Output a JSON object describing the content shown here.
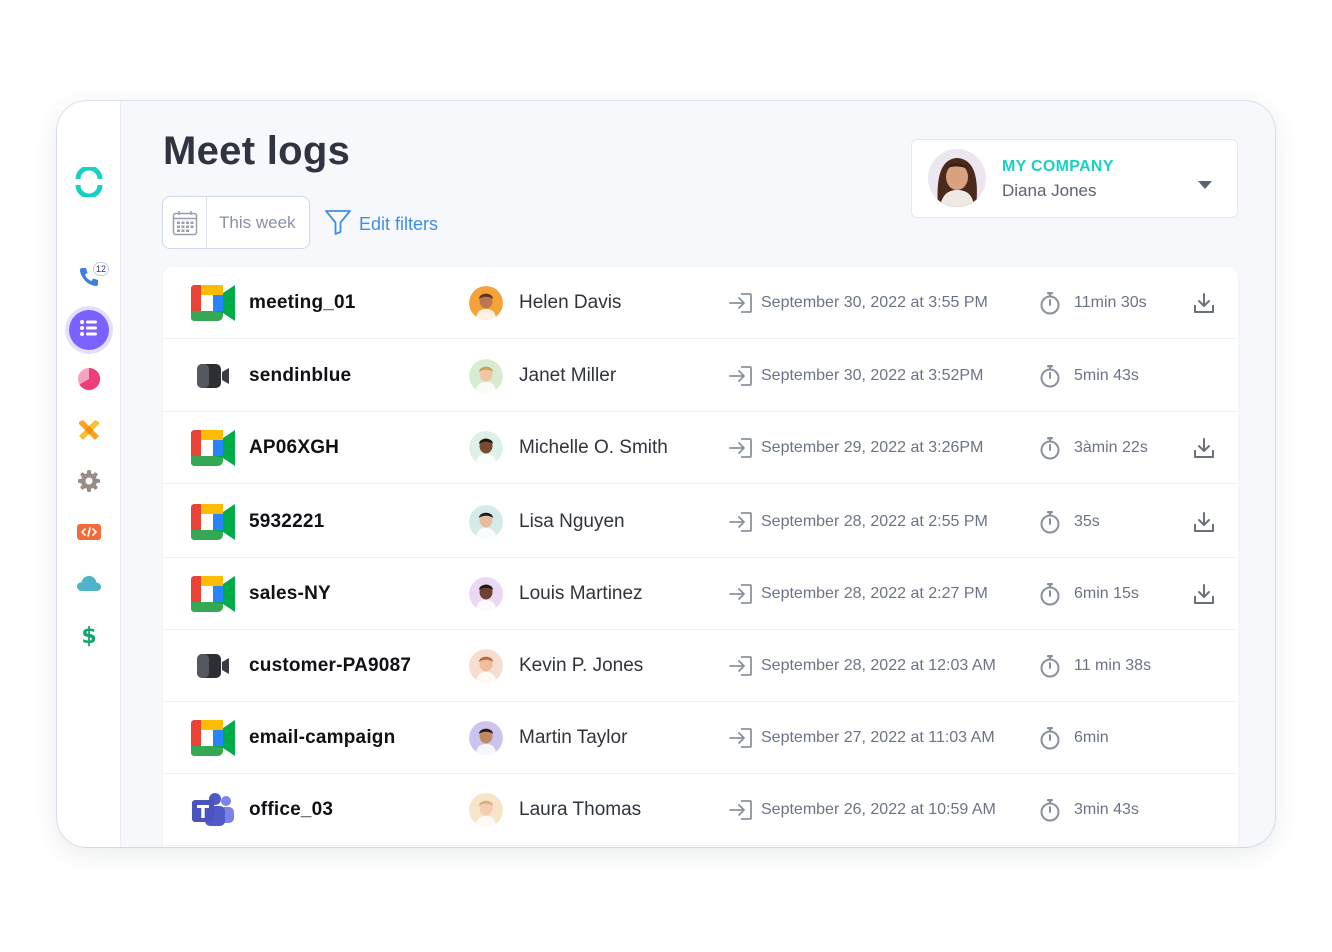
{
  "header": {
    "title": "Meet logs"
  },
  "filters": {
    "date_range": "This week",
    "edit_label": "Edit filters"
  },
  "company": {
    "name": "MY COMPANY",
    "user": "Diana Jones"
  },
  "sidebar": {
    "items": [
      {
        "id": "calls",
        "icon": "phone-icon",
        "badge": "12"
      },
      {
        "id": "logs",
        "icon": "list-icon",
        "active": true
      },
      {
        "id": "reports",
        "icon": "pie-chart-icon"
      },
      {
        "id": "tools",
        "icon": "tools-icon"
      },
      {
        "id": "settings",
        "icon": "gear-icon"
      },
      {
        "id": "developer",
        "icon": "code-icon"
      },
      {
        "id": "cloud",
        "icon": "cloud-icon"
      },
      {
        "id": "billing",
        "icon": "dollar-icon",
        "symbol": "$"
      }
    ]
  },
  "colors": {
    "accent": "#7b61ff",
    "brand": "#19d0c4",
    "link": "#3f90e4",
    "muted_text": "#6b7486"
  },
  "logs": [
    {
      "platform": "google-meet",
      "name": "meeting_01",
      "person": "Helen Davis",
      "date": "September 30, 2022 at 3:55 PM",
      "duration": "11min 30s",
      "download": true
    },
    {
      "platform": "zoom",
      "name": "sendinblue",
      "person": "Janet Miller",
      "date": "September 30, 2022 at 3:52PM",
      "duration": "5min 43s",
      "download": false
    },
    {
      "platform": "google-meet",
      "name": "AP06XGH",
      "person": "Michelle O. Smith",
      "date": "September 29, 2022 at 3:26PM",
      "duration": "3àmin 22s",
      "download": true
    },
    {
      "platform": "google-meet",
      "name": "5932221",
      "person": "Lisa Nguyen",
      "date": "September 28, 2022 at 2:55 PM",
      "duration": "35s",
      "download": true
    },
    {
      "platform": "google-meet",
      "name": "sales-NY",
      "person": "Louis  Martinez",
      "date": "September 28, 2022 at 2:27 PM",
      "duration": "6min 15s",
      "download": true
    },
    {
      "platform": "zoom",
      "name": "customer-PA9087",
      "person": "Kevin P. Jones",
      "date": "September 28, 2022 at 12:03 AM",
      "duration": "11 min 38s",
      "download": false
    },
    {
      "platform": "google-meet",
      "name": "email-campaign",
      "person": "Martin Taylor",
      "date": "September 27, 2022 at 11:03 AM",
      "duration": "6min",
      "download": false
    },
    {
      "platform": "teams",
      "name": "office_03",
      "person": "Laura Thomas",
      "date": "September 26, 2022 at 10:59 AM",
      "duration": "3min 43s",
      "download": false
    }
  ]
}
